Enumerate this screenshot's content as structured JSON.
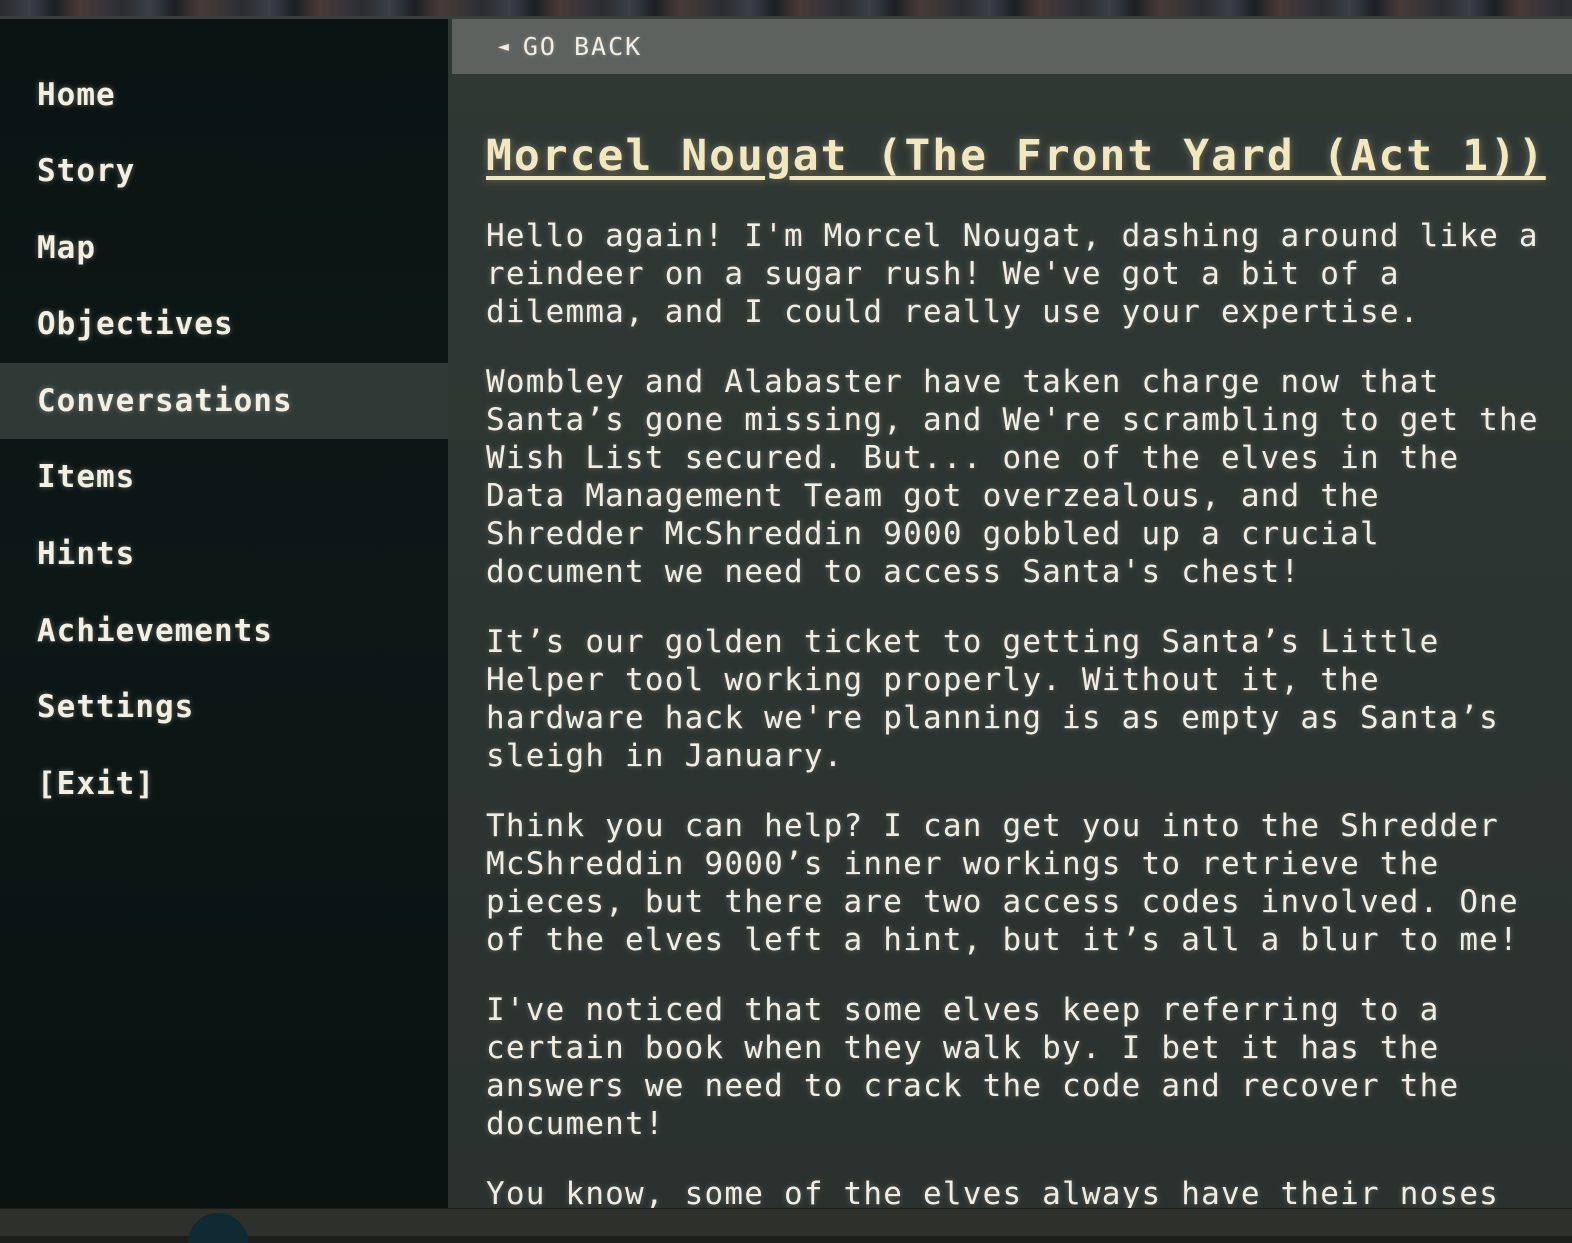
{
  "nav": {
    "items": [
      {
        "label": "Home"
      },
      {
        "label": "Story"
      },
      {
        "label": "Map"
      },
      {
        "label": "Objectives"
      },
      {
        "label": "Conversations"
      },
      {
        "label": "Items"
      },
      {
        "label": "Hints"
      },
      {
        "label": "Achievements"
      },
      {
        "label": "Settings"
      },
      {
        "label": "[Exit]"
      }
    ],
    "active": "Conversations"
  },
  "back": {
    "label": "GO BACK",
    "icon": "left-triangle-icon"
  },
  "conversation": {
    "title": "Morcel Nougat (The Front Yard (Act 1))",
    "paragraphs": [
      "Hello again! I'm Morcel Nougat, dashing around like a reindeer on a sugar rush! We've got a bit of a dilemma, and I could really use your expertise.",
      "Wombley and Alabaster have taken charge now that Santa’s gone missing, and We're scrambling to get the Wish List secured. But... one of the elves in the Data Management Team got overzealous, and the Shredder McShreddin 9000 gobbled up a crucial document we need to access Santa's chest!",
      "It’s our golden ticket to getting Santa’s Little Helper tool working properly. Without it, the hardware hack we're planning is as empty as Santa’s sleigh in January.",
      "Think you can help? I can get you into the Shredder McShreddin 9000’s inner workings to retrieve the pieces, but there are two access codes involved. One of the elves left a hint, but it’s all a blur to me!",
      "I've noticed that some elves keep referring to a certain book when they walk by. I bet it has the answers we need to crack the code and recover the document!",
      "You know, some of the elves always have their noses in"
    ]
  },
  "colors": {
    "sidebar_bg": "#0b1413",
    "active_item_bg": "#2f3a37",
    "content_bg": "#2d3532",
    "back_bar_bg": "#5d625f",
    "title_color": "#f2e7bd",
    "text_color": "#f0ede4"
  }
}
